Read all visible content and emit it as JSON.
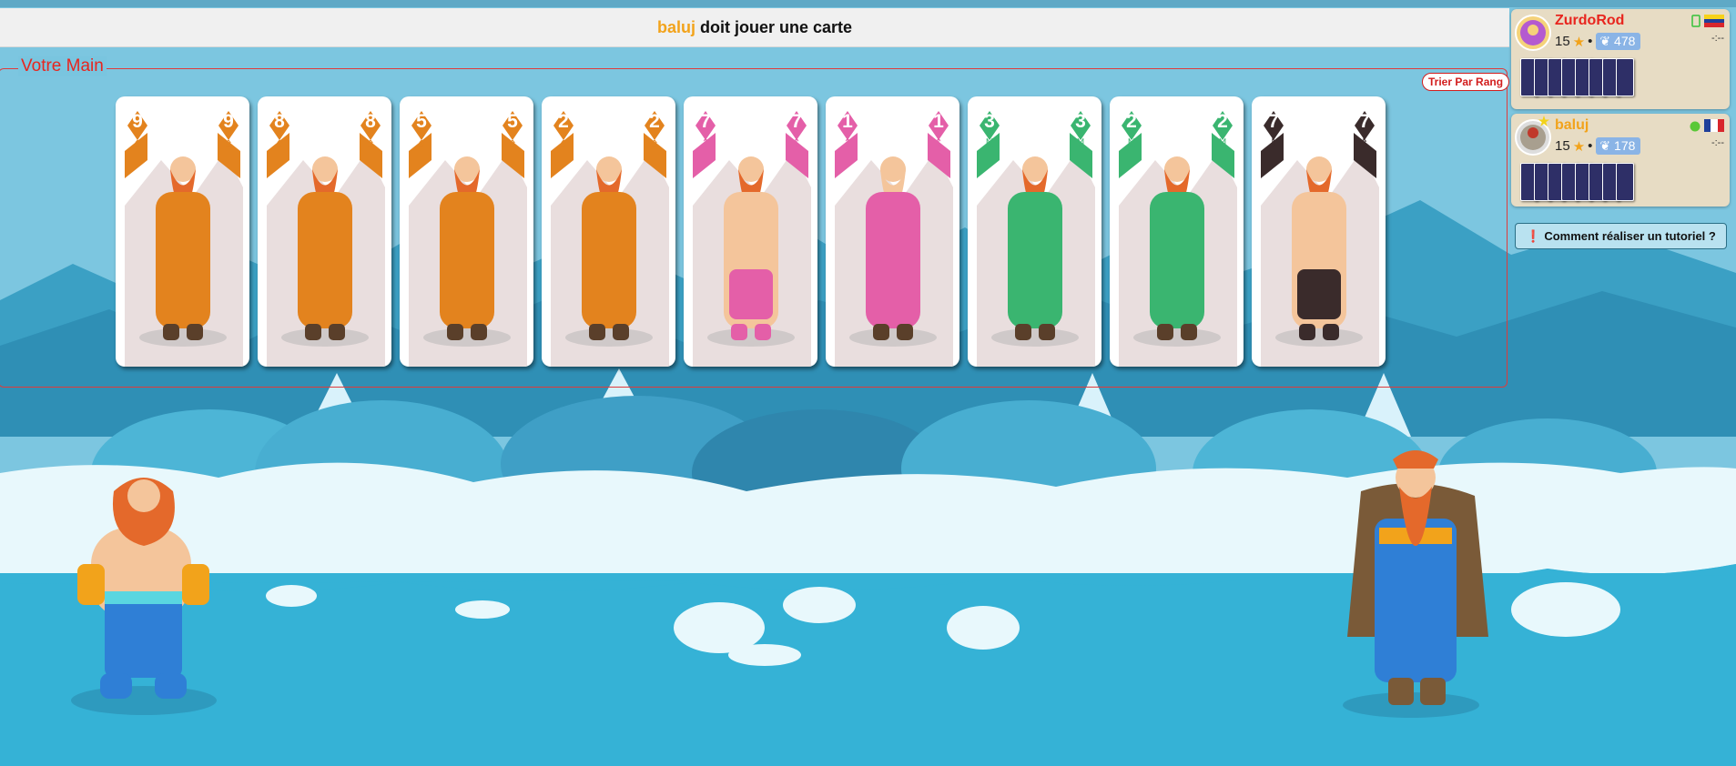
{
  "status": {
    "player": "baluj",
    "message": "doit jouer une carte"
  },
  "hand": {
    "title": "Votre Main",
    "sort_button": "Trier Par Rang",
    "cards": [
      {
        "rank": "9",
        "rune": "ᛟ",
        "color": "#e3831e",
        "figure": "elder-with-raven"
      },
      {
        "rank": "8",
        "rune": "ᛟ",
        "color": "#e3831e",
        "figure": "viking-with-chest"
      },
      {
        "rank": "5",
        "rune": "ᛟ",
        "color": "#e3831e",
        "figure": "shaman-with-staff"
      },
      {
        "rank": "2",
        "rune": "ᛟ",
        "color": "#e3831e",
        "figure": "bard-with-lyre"
      },
      {
        "rank": "7",
        "rune": "ᛏ",
        "color": "#e45fa8",
        "figure": "warrior"
      },
      {
        "rank": "1",
        "rune": "ᛏ",
        "color": "#e45fa8",
        "figure": "hooded-woman"
      },
      {
        "rank": "3",
        "rune": "ᛞ",
        "color": "#3ab570",
        "figure": "tree-spirit"
      },
      {
        "rank": "2",
        "rune": "ᛞ",
        "color": "#3ab570",
        "figure": "bard-with-lyre"
      },
      {
        "rank": "7",
        "rune": "ᛒ",
        "color": "#3a2b2b",
        "figure": "warrior"
      }
    ]
  },
  "players": [
    {
      "name": "ZurdoRod",
      "name_color": "#e8251e",
      "score": "15",
      "elo": "478",
      "clock": "-:--",
      "cards": 8,
      "flag": "venezuela-flag",
      "status": "phone-icon"
    },
    {
      "name": "baluj",
      "name_color": "#f2a31b",
      "score": "15",
      "elo": "178",
      "clock": "-:--",
      "cards": 8,
      "flag": "france-flag",
      "status": "online-dot"
    }
  ],
  "tutorial_button": "Comment réaliser un tutoriel ?",
  "colors": {
    "accent_red": "#e8251e",
    "accent_orange": "#f2a31b",
    "sky": "#7cc6e0",
    "sea": "#35b2d6"
  }
}
